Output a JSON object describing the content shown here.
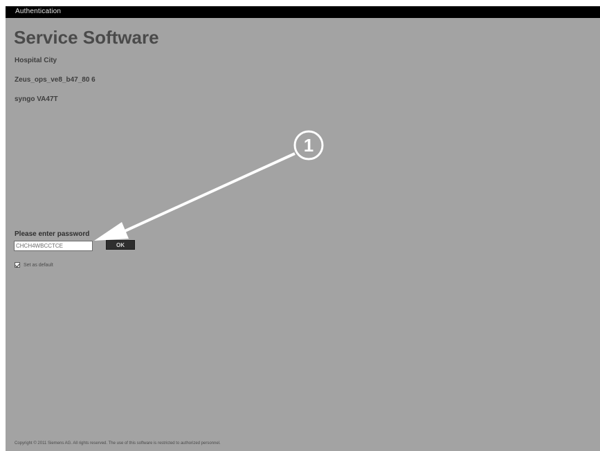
{
  "window": {
    "title": "Authentication"
  },
  "main": {
    "title": "Service Software",
    "info_lines": [
      "Hospital City",
      "Zeus_ops_ve8_b47_80 6",
      "syngo VA47T"
    ]
  },
  "login": {
    "password_label": "Please enter password",
    "password_value": "CHCH4WBCCTCE",
    "ok_label": "OK",
    "remember_label": "Set as default",
    "remember_checked": true
  },
  "callout": {
    "number": "1"
  },
  "footer": {
    "text": "Copyright © 2011 Siemens AG. All rights reserved. The use of this software is restricted to authorized personnel."
  }
}
